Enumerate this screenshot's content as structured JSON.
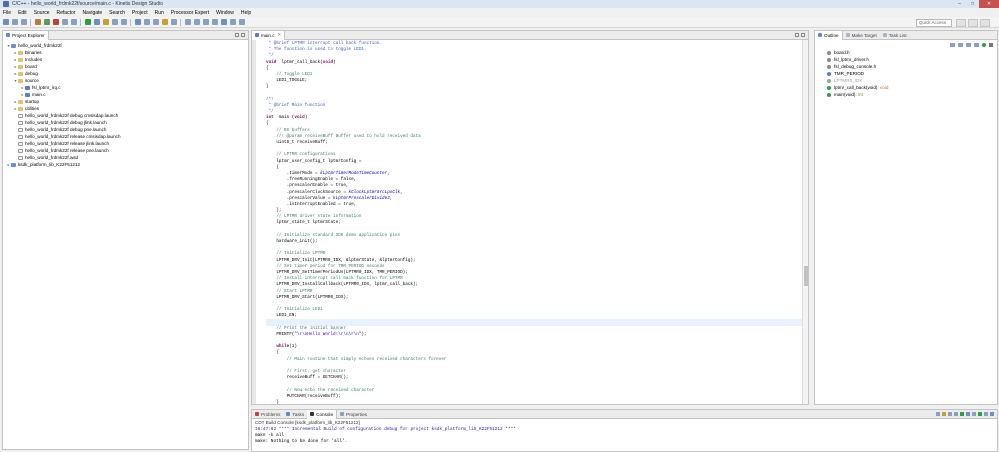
{
  "window": {
    "title": "C/C++ - hello_world_frdmk22f/source/main.c - Kinetis Design Studio"
  },
  "menu": [
    "File",
    "Edit",
    "Source",
    "Refactor",
    "Navigate",
    "Search",
    "Project",
    "Run",
    "Processor Expert",
    "Window",
    "Help"
  ],
  "quick_access": "Quick Access",
  "explorer": {
    "tab": "Project Explorer",
    "items": [
      {
        "label": "hello_world_frdmk22f",
        "depth": 0,
        "arrow": "▾",
        "icon": "proj"
      },
      {
        "label": "Binaries",
        "depth": 1,
        "arrow": "▸",
        "icon": "folder"
      },
      {
        "label": "Includes",
        "depth": 1,
        "arrow": "▸",
        "icon": "folder"
      },
      {
        "label": "board",
        "depth": 1,
        "arrow": "▸",
        "icon": "folder"
      },
      {
        "label": "debug",
        "depth": 1,
        "arrow": "▸",
        "icon": "folder"
      },
      {
        "label": "source",
        "depth": 1,
        "arrow": "▾",
        "icon": "folder"
      },
      {
        "label": "fsl_lptmr_irq.c",
        "depth": 2,
        "arrow": "▸",
        "icon": "cfile"
      },
      {
        "label": "main.c",
        "depth": 2,
        "arrow": "▸",
        "icon": "cfile"
      },
      {
        "label": "startup",
        "depth": 1,
        "arrow": "▸",
        "icon": "folder"
      },
      {
        "label": "utilities",
        "depth": 1,
        "arrow": "▸",
        "icon": "folder"
      },
      {
        "label": "hello_world_frdmk22f debug cmsisdap.launch",
        "depth": 1,
        "arrow": "",
        "icon": "file"
      },
      {
        "label": "hello_world_frdmk22f debug jlink.launch",
        "depth": 1,
        "arrow": "",
        "icon": "file"
      },
      {
        "label": "hello_world_frdmk22f debug pne.launch",
        "depth": 1,
        "arrow": "",
        "icon": "file"
      },
      {
        "label": "hello_world_frdmk22f release cmsisdap.launch",
        "depth": 1,
        "arrow": "",
        "icon": "file"
      },
      {
        "label": "hello_world_frdmk22f release jlink.launch",
        "depth": 1,
        "arrow": "",
        "icon": "file"
      },
      {
        "label": "hello_world_frdmk22f release pne.launch",
        "depth": 1,
        "arrow": "",
        "icon": "file"
      },
      {
        "label": "hello_world_frdmk22f.wsd",
        "depth": 1,
        "arrow": "",
        "icon": "file"
      },
      {
        "label": "ksdk_platform_lib_K22F51212",
        "depth": 0,
        "arrow": "▸",
        "icon": "proj"
      }
    ]
  },
  "editor": {
    "tab": "main.c",
    "lines": [
      [
        [
          "c-doc",
          " * @brief LPTMR interrupt call back function."
        ]
      ],
      [
        [
          "c-doc",
          " * The function is used to toggle LED1."
        ]
      ],
      [
        [
          "c-doc",
          " */"
        ]
      ],
      [
        [
          "c-kw",
          "void"
        ],
        [
          "",
          "  lptmr_call_back("
        ],
        [
          "c-kw",
          "void"
        ],
        [
          "",
          ")"
        ]
      ],
      [
        [
          "",
          "{"
        ]
      ],
      [
        [
          "c-com",
          "    // Toggle LED1"
        ]
      ],
      [
        [
          "",
          "    LED1_TOGGLE;"
        ]
      ],
      [
        [
          "",
          "}"
        ]
      ],
      [
        [
          "",
          ""
        ]
      ],
      [
        [
          "c-doc",
          "/*!"
        ]
      ],
      [
        [
          "c-doc",
          " * @brief Main function"
        ]
      ],
      [
        [
          "c-doc",
          " */"
        ]
      ],
      [
        [
          "c-kw",
          "int"
        ],
        [
          "",
          "  main ("
        ],
        [
          "c-kw",
          "void"
        ],
        [
          "",
          ")"
        ]
      ],
      [
        [
          "",
          "{"
        ]
      ],
      [
        [
          "c-com",
          "    // RX buffers"
        ]
      ],
      [
        [
          "c-com",
          "    //! @param receiveBuff Buffer used to hold received data"
        ]
      ],
      [
        [
          "",
          "    uint8_t receiveBuff;"
        ]
      ],
      [
        [
          "",
          ""
        ]
      ],
      [
        [
          "c-com",
          "    // LPTMR configurations"
        ]
      ],
      [
        [
          "",
          "    lptmr_user_config_t lptmrConfig ="
        ]
      ],
      [
        [
          "",
          "    {"
        ]
      ],
      [
        [
          "",
          "        .timerMode = "
        ],
        [
          "c-it",
          "kLptmrTimerModeTimeCounter"
        ],
        [
          "",
          ","
        ]
      ],
      [
        [
          "",
          "        .freeRunningEnable = false,"
        ]
      ],
      [
        [
          "",
          "        .prescalerEnable = true,"
        ]
      ],
      [
        [
          "",
          "        .prescalerClockSource = "
        ],
        [
          "c-it",
          "kClockLptmrSrcLpoClk"
        ],
        [
          "",
          ","
        ]
      ],
      [
        [
          "",
          "        .prescalerValue = "
        ],
        [
          "c-it",
          "kLptmrPrescalerDivide2"
        ],
        [
          "",
          ","
        ]
      ],
      [
        [
          "",
          "        .isInterruptEnabled = true,"
        ]
      ],
      [
        [
          "",
          "    };"
        ]
      ],
      [
        [
          "c-com",
          "    // LPTMR driver state information"
        ]
      ],
      [
        [
          "",
          "    lptmr_state_t lptmrState;"
        ]
      ],
      [
        [
          "",
          ""
        ]
      ],
      [
        [
          "c-com",
          "    // Initialize standard SDK demo application pins"
        ]
      ],
      [
        [
          "",
          "    hardware_init();"
        ]
      ],
      [
        [
          "",
          ""
        ]
      ],
      [
        [
          "c-com",
          "    // Initialize LPTMR"
        ]
      ],
      [
        [
          "",
          "    LPTMR_DRV_Init(LPTMR0_IDX, &lptmrState, &lptmrConfig);"
        ]
      ],
      [
        [
          "c-com",
          "    // Set timer period for TMR_PERIOD seconds"
        ]
      ],
      [
        [
          "",
          "    LPTMR_DRV_SetTimerPeriodUs(LPTMR0_IDX, TMR_PERIOD);"
        ]
      ],
      [
        [
          "c-com",
          "    // Install interrupt call back function for LPTMR"
        ]
      ],
      [
        [
          "",
          "    LPTMR_DRV_InstallCallback(LPTMR0_IDX, lptmr_call_back);"
        ]
      ],
      [
        [
          "c-com",
          "    // Start LPTMR"
        ]
      ],
      [
        [
          "",
          "    LPTMR_DRV_Start(LPTMR0_IDX);"
        ]
      ],
      [
        [
          "",
          ""
        ]
      ],
      [
        [
          "c-com",
          "    // Initialize LED1"
        ]
      ],
      [
        [
          "",
          "    LED1_EN;"
        ]
      ],
      [
        [
          "",
          ""
        ]
      ],
      [
        [
          "c-com",
          "    // Print the initial banner"
        ]
      ],
      [
        [
          "",
          "    PRINTF("
        ],
        [
          "c-str",
          "\"\\r\\nHello World!\\r\\n\\r\\n\""
        ],
        [
          "",
          ");"
        ]
      ],
      [
        [
          "",
          ""
        ]
      ],
      [
        [
          "c-kw",
          "    while"
        ],
        [
          "",
          "(1)"
        ]
      ],
      [
        [
          "",
          "    {"
        ]
      ],
      [
        [
          "c-com",
          "        // Main routine that simply echoes received characters forever"
        ]
      ],
      [
        [
          "",
          ""
        ]
      ],
      [
        [
          "c-com",
          "        // First, get character"
        ]
      ],
      [
        [
          "",
          "        receiveBuff = GETCHAR();"
        ]
      ],
      [
        [
          "",
          ""
        ]
      ],
      [
        [
          "c-com",
          "        // Now echo the received character"
        ]
      ],
      [
        [
          "",
          "        PUTCHAR(receiveBuff);"
        ]
      ],
      [
        [
          "",
          "    }"
        ]
      ],
      [
        [
          "",
          "}"
        ]
      ]
    ]
  },
  "outline": {
    "tabs": [
      "Outline",
      "Make Target",
      "Task List"
    ],
    "items": [
      {
        "label": "board.h",
        "detail": "",
        "color": "#8a8a8a"
      },
      {
        "label": "fsl_lptmr_driver.h",
        "detail": "",
        "color": "#8a8a8a"
      },
      {
        "label": "fsl_debug_console.h",
        "detail": "",
        "color": "#8a8a8a"
      },
      {
        "label": "TMR_PERIOD",
        "detail": "",
        "color": "#5a7fc0"
      },
      {
        "label": "LPTMR0_IDX",
        "detail": "",
        "color": "#a0a0a0",
        "dim": true
      },
      {
        "label": "lptmr_call_back(void)",
        "detail": " : void",
        "color": "#2e9e3e"
      },
      {
        "label": "main(void)",
        "detail": " : int",
        "color": "#2e9e3e"
      }
    ]
  },
  "bottom": {
    "tabs": [
      "Problems",
      "Tasks",
      "Console",
      "Properties"
    ],
    "console_title": "CDT Build Console [ksdk_platform_lib_K22F51212]",
    "lines": [
      {
        "text": "16:47:02 **** Incremental Build of configuration debug for project ksdk_platform_lib_K22F51212 ****",
        "cls": "c-blue"
      },
      {
        "text": "make -k all",
        "cls": ""
      },
      {
        "text": "make: Nothing to be done for 'all'.",
        "cls": ""
      }
    ]
  }
}
